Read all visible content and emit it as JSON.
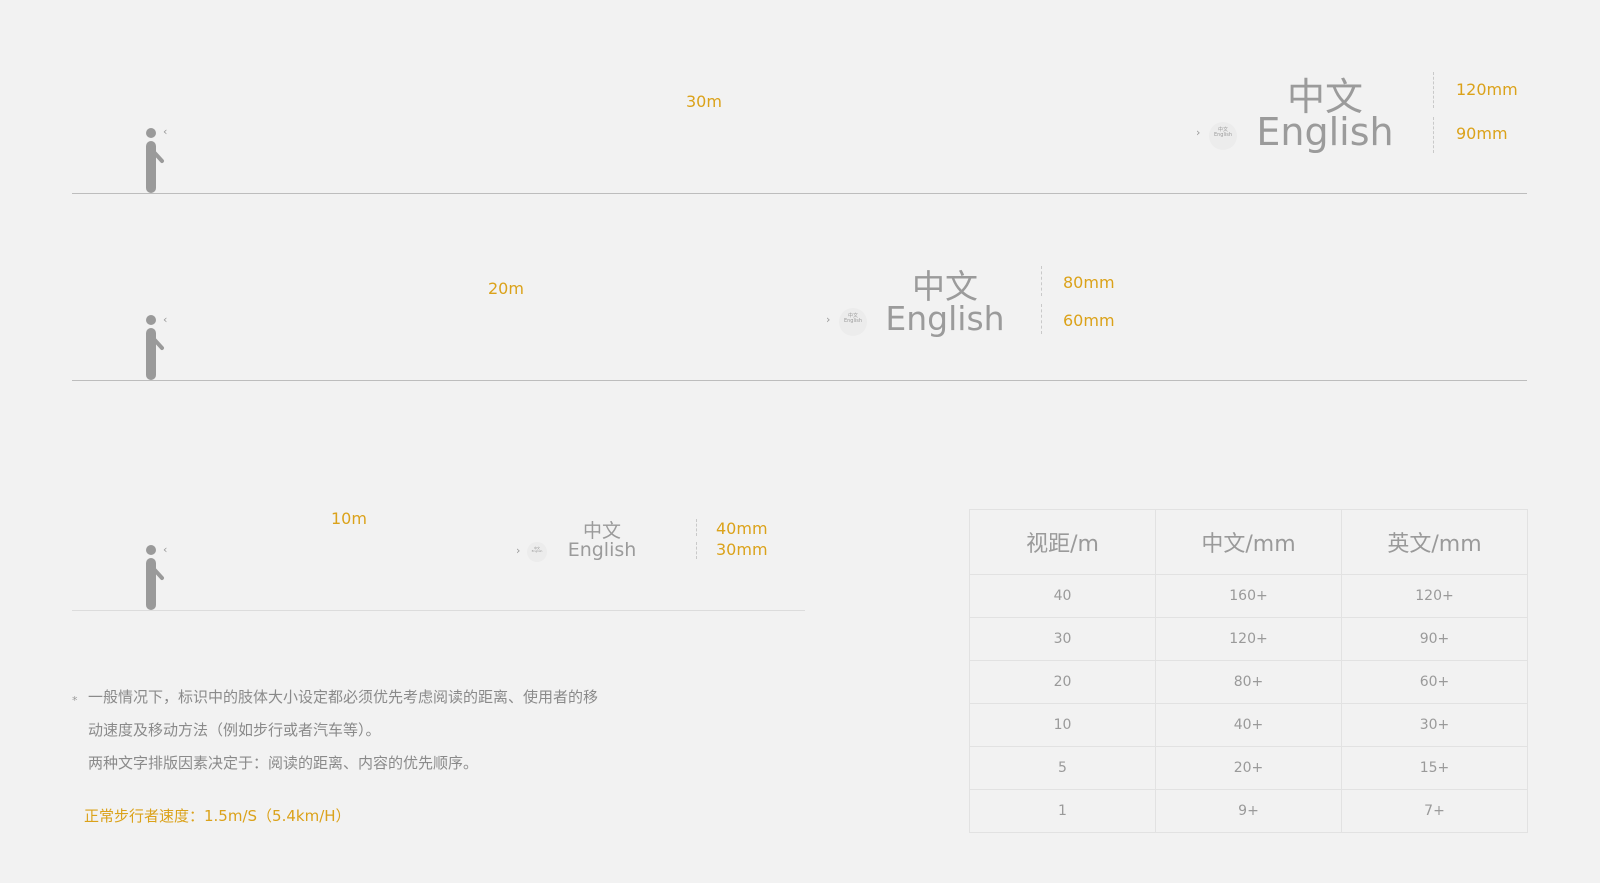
{
  "rows": [
    {
      "distance": "30m",
      "cn": "中文",
      "en": "English",
      "cn_size": "120mm",
      "en_size": "90mm",
      "badge_cn": "中文",
      "badge_en": "English"
    },
    {
      "distance": "20m",
      "cn": "中文",
      "en": "English",
      "cn_size": "80mm",
      "en_size": "60mm",
      "badge_cn": "中文",
      "badge_en": "English"
    },
    {
      "distance": "10m",
      "cn": "中文",
      "en": "English",
      "cn_size": "40mm",
      "en_size": "30mm",
      "badge_cn": "中文",
      "badge_en": "English"
    }
  ],
  "glyphs": {
    "chevron_right": "›",
    "chevron_left": "‹"
  },
  "note": {
    "star": "*",
    "lines": [
      "一般情况下，标识中的肢体大小设定都必须优先考虑阅读的距离、使用者的移",
      "动速度及移动方法（例如步行或者汽车等）。",
      "两种文字排版因素决定于：阅读的距离、内容的优先顺序。"
    ],
    "speed": "正常步行者速度：1.5m/S（5.4km/H）"
  },
  "table": {
    "headers": [
      "视距/m",
      "中文/mm",
      "英文/mm"
    ],
    "rows": [
      [
        "40",
        "160+",
        "120+"
      ],
      [
        "30",
        "120+",
        "90+"
      ],
      [
        "20",
        "80+",
        "60+"
      ],
      [
        "10",
        "40+",
        "30+"
      ],
      [
        "5",
        "20+",
        "15+"
      ],
      [
        "1",
        "9+",
        "7+"
      ]
    ]
  },
  "colors": {
    "accent": "#dba21a",
    "text": "#9b9b9b",
    "background": "#f2f2f2"
  }
}
